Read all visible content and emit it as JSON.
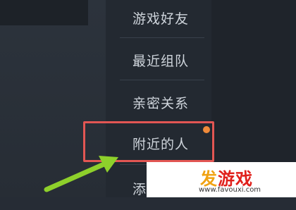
{
  "menu": {
    "items": [
      {
        "label": "游戏好友"
      },
      {
        "label": "最近组队"
      },
      {
        "label": "亲密关系"
      },
      {
        "label": "附近的人"
      },
      {
        "label": "添加好友"
      }
    ]
  },
  "watermark": {
    "logo_accent": "发",
    "logo_rest": "游戏",
    "url": "www.favouxi.com"
  },
  "colors": {
    "highlight": "#e25653",
    "notification": "#f08a3a",
    "arrow": "#8ed02b"
  },
  "icons": [
    "notification-dot-icon",
    "pointer-arrow-icon"
  ]
}
